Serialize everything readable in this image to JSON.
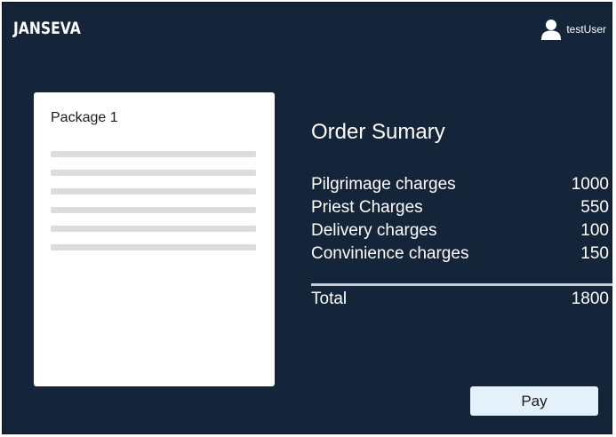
{
  "header": {
    "brand": "JANSEVA",
    "user_name": "testUser",
    "user_icon": "user-icon"
  },
  "package": {
    "title": "Package 1",
    "placeholder_lines": 6
  },
  "summary": {
    "title": "Order Sumary",
    "items": [
      {
        "label": "Pilgrimage charges",
        "value": "1000"
      },
      {
        "label": "Priest Charges",
        "value": "550"
      },
      {
        "label": "Delivery charges",
        "value": "100"
      },
      {
        "label": "Convinience charges",
        "value": "150"
      }
    ],
    "total_label": "Total",
    "total_value": "1800"
  },
  "actions": {
    "pay_label": "Pay"
  },
  "colors": {
    "background": "#14253a",
    "card": "#ffffff",
    "pay_button": "#e4f1fb"
  }
}
